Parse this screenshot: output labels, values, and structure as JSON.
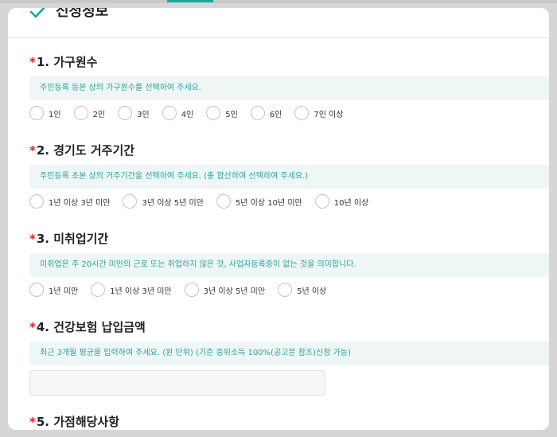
{
  "header": {
    "title": "신청정보"
  },
  "sections": [
    {
      "number": "1.",
      "title": "가구원수",
      "required_mark": "*",
      "hint": "주민등록 등본 상의 가구원수를 선택하여 주세요.",
      "options": [
        "1인",
        "2인",
        "3인",
        "4인",
        "5인",
        "6인",
        "7인 이상"
      ]
    },
    {
      "number": "2.",
      "title": "경기도 거주기간",
      "required_mark": "*",
      "hint": "주민등록 초본 상의 거주기간을 선택하여 주세요. (총 합산하여 선택하여 주세요.)",
      "options": [
        "1년 이상 3년 미만",
        "3년 이상 5년 미만",
        "5년 이상 10년 미만",
        "10년 이상"
      ]
    },
    {
      "number": "3.",
      "title": "미취업기간",
      "required_mark": "*",
      "hint": "미취업은 주 20시간 미만의 근로 또는 취업하지 않은 것, 사업자등록증이 없는 것을 의미합니다.",
      "options": [
        "1년 미만",
        "1년 이상 3년 미만",
        "3년 이상 5년 미만",
        "5년 이상"
      ]
    },
    {
      "number": "4.",
      "title": "건강보험 납입금액",
      "required_mark": "*",
      "hint": "최근 3개월 평균을 입력하여 주세요. (원 단위) (기준 중위소득 100%(공고문 참조)신청 가능)",
      "input_value": "",
      "input_placeholder": ""
    },
    {
      "number": "5.",
      "title": "가점해당사항",
      "required_mark": "*"
    }
  ],
  "icons": {
    "header": "check-icon"
  },
  "colors": {
    "accent": "#1aa89a",
    "hint_text": "#2ba49a",
    "hint_bg": "#eef6f6",
    "required": "#e0202a"
  }
}
